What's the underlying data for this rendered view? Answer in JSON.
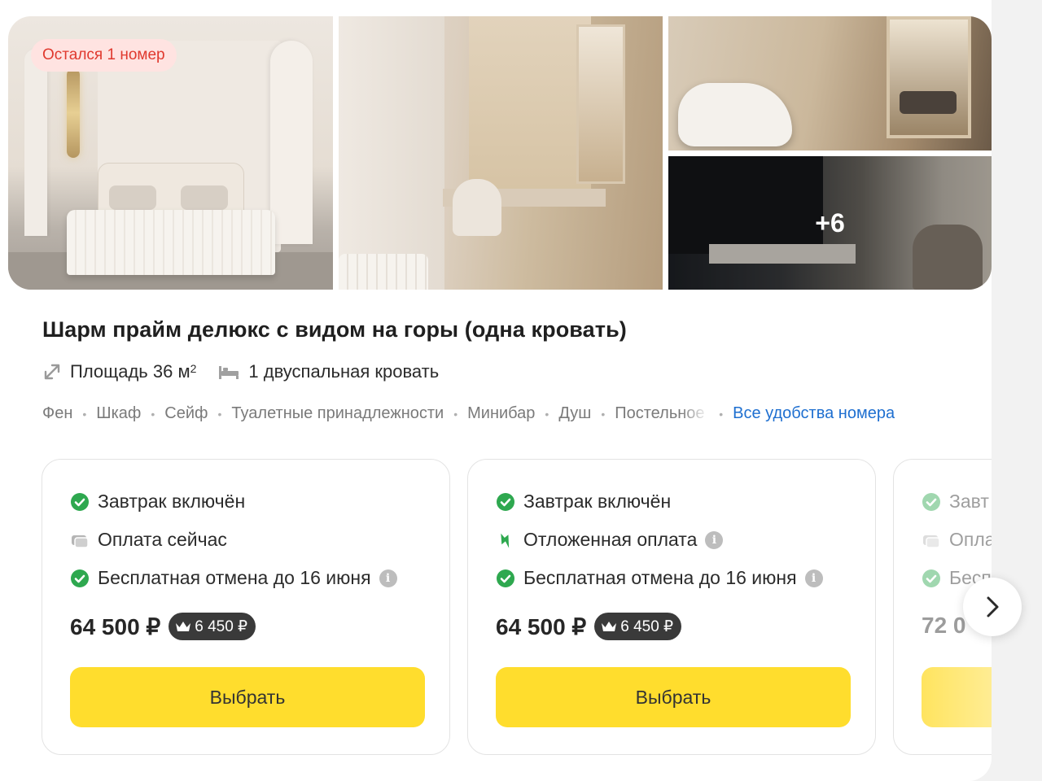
{
  "gallery": {
    "availability_badge": "Остался 1 номер",
    "more_photos": "+6",
    "photos": [
      "bedroom-photo",
      "wardrobe-desk-photo",
      "vanity-chair-photo",
      "tv-lounge-photo"
    ]
  },
  "room": {
    "title": "Шарм прайм делюкс с видом на горы (одна кровать)",
    "area_label": "Площадь 36 м",
    "area_sup": "2",
    "bed_label": "1 двуспальная кровать",
    "amenities": [
      "Фен",
      "Шкаф",
      "Сейф",
      "Туалетные принадлежности",
      "Минибар",
      "Душ",
      "Постельное"
    ],
    "all_amenities_link": "Все удобства номера"
  },
  "tariffs": [
    {
      "features": [
        {
          "icon": "check-circle-icon",
          "text": "Завтрак включён"
        },
        {
          "icon": "card-icon",
          "text": "Оплата сейчас"
        },
        {
          "icon": "check-circle-icon",
          "text": "Бесплатная отмена до 16 июня",
          "info": true
        }
      ],
      "price": "64 500 ₽",
      "cashback": "6 450 ₽",
      "button": "Выбрать"
    },
    {
      "features": [
        {
          "icon": "check-circle-icon",
          "text": "Завтрак включён"
        },
        {
          "icon": "deferred-payment-icon",
          "text": "Отложенная оплата",
          "info": true
        },
        {
          "icon": "check-circle-icon",
          "text": "Бесплатная отмена до 16 июня",
          "info": true
        }
      ],
      "price": "64 500 ₽",
      "cashback": "6 450 ₽",
      "button": "Выбрать"
    },
    {
      "features": [
        {
          "icon": "check-circle-icon",
          "text": "Завт"
        },
        {
          "icon": "card-icon",
          "text": "Опла"
        },
        {
          "icon": "check-circle-icon",
          "text": "Бесп"
        }
      ],
      "price": "72 0",
      "button": ""
    }
  ],
  "colors": {
    "accent_yellow": "#ffdd2d",
    "check_green": "#2ea84f",
    "link_blue": "#1e6fd0",
    "badge_red": "#e0392e"
  }
}
